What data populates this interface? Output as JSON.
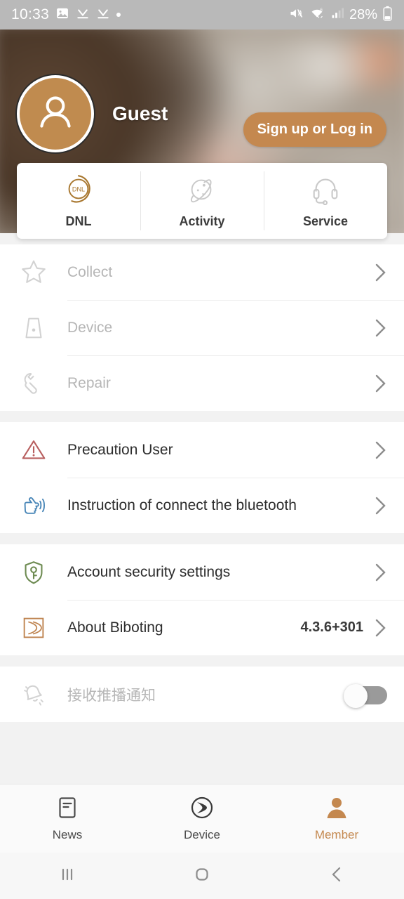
{
  "statusbar": {
    "time": "10:33",
    "battery": "28%",
    "left_icons": [
      "image-icon",
      "download-complete-icon",
      "download-complete-icon",
      "dot-icon"
    ],
    "right_icons": [
      "mute-icon",
      "wifi-icon",
      "cellular-signal-icon",
      "battery-icon"
    ]
  },
  "header": {
    "username": "Guest",
    "signup_label": "Sign up or Log in",
    "avatar_icon": "person-icon",
    "accent_color": "#c4884f"
  },
  "quick_card": {
    "items": [
      {
        "label": "DNL",
        "icon": "dnl-logo-icon",
        "icon_text": "DNL",
        "active": true
      },
      {
        "label": "Activity",
        "icon": "planet-icon",
        "active": false
      },
      {
        "label": "Service",
        "icon": "headset-icon",
        "active": false
      }
    ]
  },
  "groups": [
    {
      "name": "account-shortcuts",
      "rows": [
        {
          "label": "Collect",
          "icon": "star-icon",
          "dim": true,
          "value": "",
          "chevron": true
        },
        {
          "label": "Device",
          "icon": "device-lamp-icon",
          "dim": true,
          "value": "",
          "chevron": true
        },
        {
          "label": "Repair",
          "icon": "wrench-icon",
          "dim": true,
          "value": "",
          "chevron": true
        }
      ]
    },
    {
      "name": "help",
      "rows": [
        {
          "label": "Precaution User",
          "icon": "warning-triangle-icon",
          "dim": false,
          "value": "",
          "chevron": true
        },
        {
          "label": "Instruction of connect the bluetooth",
          "icon": "hand-pointer-signal-icon",
          "dim": false,
          "value": "",
          "chevron": true
        }
      ]
    },
    {
      "name": "settings",
      "rows": [
        {
          "label": "Account security settings",
          "icon": "shield-key-icon",
          "dim": false,
          "value": "",
          "chevron": true
        },
        {
          "label": "About Biboting",
          "icon": "biboting-logo-icon",
          "dim": false,
          "value": "4.3.6+301",
          "chevron": true
        }
      ]
    },
    {
      "name": "notifications",
      "rows": [
        {
          "label": "接收推播通知",
          "icon": "bell-off-icon",
          "dim": true,
          "value": "",
          "chevron": false,
          "toggle": "off"
        }
      ]
    }
  ],
  "bottom_nav": {
    "items": [
      {
        "label": "News",
        "icon": "news-document-icon",
        "active": false
      },
      {
        "label": "Device",
        "icon": "device-crescent-icon",
        "active": false
      },
      {
        "label": "Member",
        "icon": "member-person-icon",
        "active": true
      }
    ],
    "active_color": "#c4884f"
  },
  "system_nav": {
    "items": [
      {
        "icon": "recents-icon"
      },
      {
        "icon": "home-icon"
      },
      {
        "icon": "back-icon"
      }
    ]
  },
  "icon_colors": {
    "dnl_gold": "#a8772f",
    "muted_gray": "#c9c9c9",
    "warning_red": "#b85f5f",
    "bluetooth_blue": "#4a87b8",
    "shield_green": "#6e8b52",
    "biboting_bronze": "#bf8450"
  }
}
